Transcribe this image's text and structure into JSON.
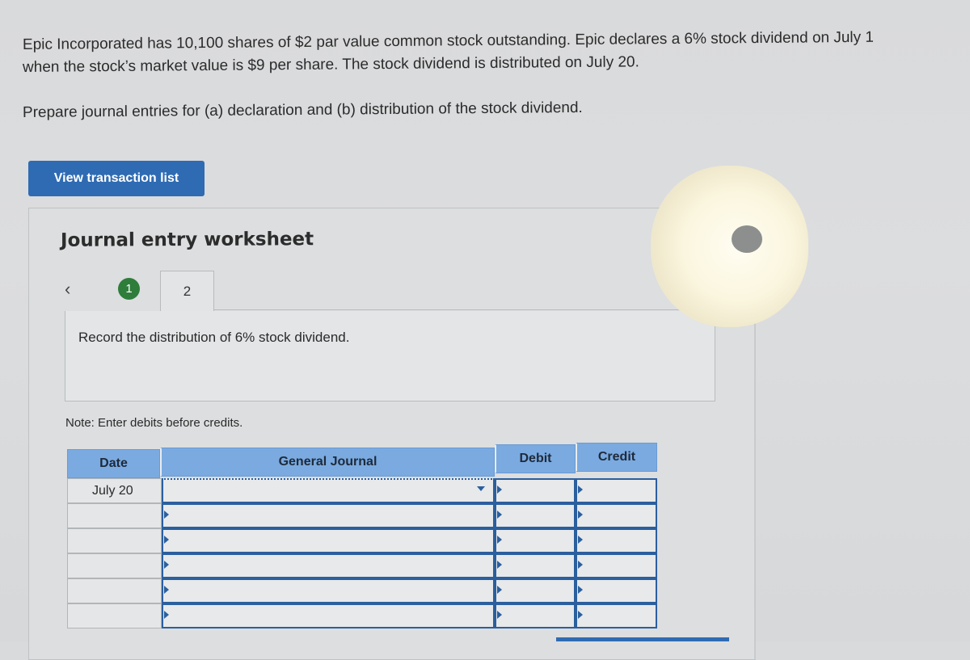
{
  "question": {
    "line1": "Epic Incorporated has 10,100 shares of $2 par value common stock outstanding. Epic declares a 6% stock dividend on July 1",
    "line2": "when the stock’s market value is $9 per share. The stock dividend is distributed on July 20.",
    "line3": "Prepare journal entries for (a) declaration and (b) distribution of the stock dividend."
  },
  "buttons": {
    "view_transactions": "View transaction list"
  },
  "worksheet": {
    "title": "Journal entry worksheet",
    "prev_icon": "‹",
    "next_icon": "›",
    "steps": [
      {
        "label": "1",
        "status": "completed"
      },
      {
        "label": "2",
        "status": "active"
      }
    ],
    "instruction": "Record the distribution of 6% stock dividend.",
    "note": "Note: Enter debits before credits."
  },
  "journal_table": {
    "headers": {
      "date": "Date",
      "general_journal": "General Journal",
      "debit": "Debit",
      "credit": "Credit"
    },
    "rows": [
      {
        "date": "July 20",
        "account": "",
        "debit": "",
        "credit": ""
      },
      {
        "date": "",
        "account": "",
        "debit": "",
        "credit": ""
      },
      {
        "date": "",
        "account": "",
        "debit": "",
        "credit": ""
      },
      {
        "date": "",
        "account": "",
        "debit": "",
        "credit": ""
      },
      {
        "date": "",
        "account": "",
        "debit": "",
        "credit": ""
      },
      {
        "date": "",
        "account": "",
        "debit": "",
        "credit": ""
      }
    ]
  },
  "colors": {
    "primary_button": "#2f6bb3",
    "step_completed": "#2e7d3a",
    "table_header": "#7aaae0"
  }
}
